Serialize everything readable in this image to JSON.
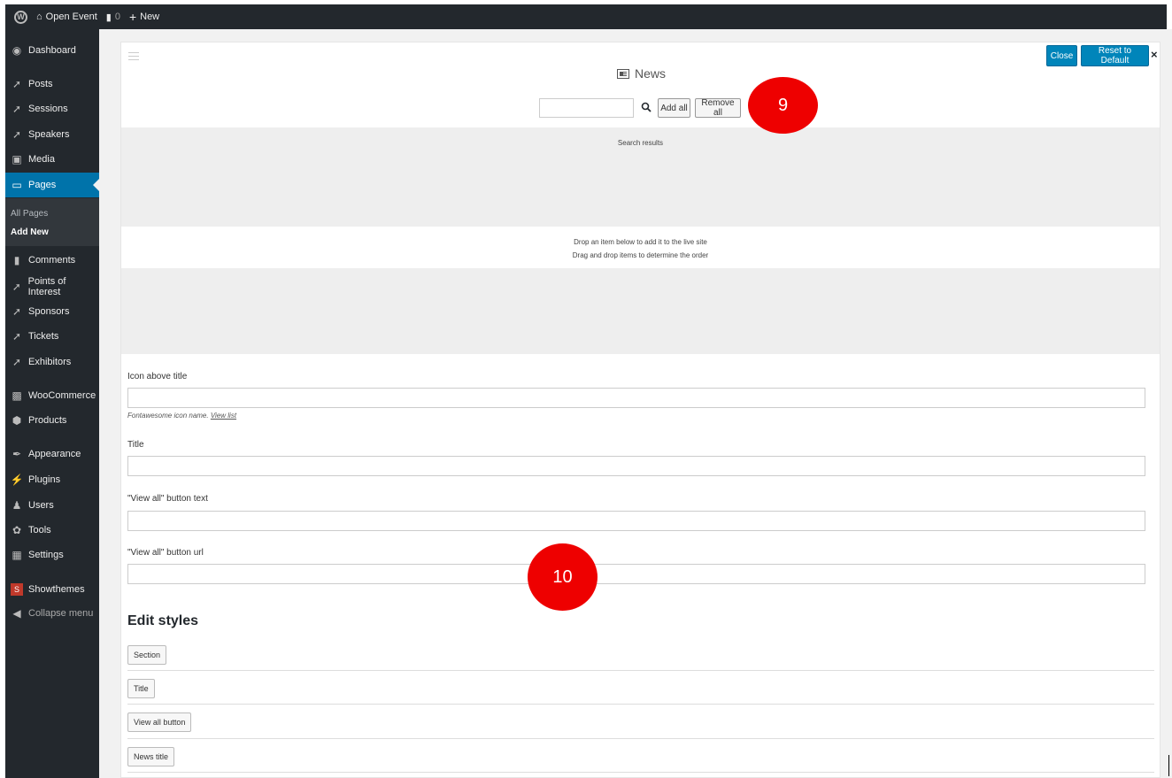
{
  "adminbar": {
    "site_name": "Open Event",
    "comments_count": "0",
    "new_label": "New"
  },
  "sidebar": {
    "items": [
      {
        "label": "Dashboard",
        "icon": "dashboard-icon"
      },
      {
        "label": "Posts",
        "icon": "pin-icon"
      },
      {
        "label": "Sessions",
        "icon": "pin-icon"
      },
      {
        "label": "Speakers",
        "icon": "pin-icon"
      },
      {
        "label": "Media",
        "icon": "media-icon"
      },
      {
        "label": "Pages",
        "icon": "pages-icon",
        "active": true
      },
      {
        "label": "Comments",
        "icon": "comment-icon"
      },
      {
        "label": "Points of Interest",
        "icon": "pin-icon"
      },
      {
        "label": "Sponsors",
        "icon": "pin-icon"
      },
      {
        "label": "Tickets",
        "icon": "pin-icon"
      },
      {
        "label": "Exhibitors",
        "icon": "pin-icon"
      },
      {
        "label": "WooCommerce",
        "icon": "woocommerce-icon"
      },
      {
        "label": "Products",
        "icon": "products-icon"
      },
      {
        "label": "Appearance",
        "icon": "brush-icon"
      },
      {
        "label": "Plugins",
        "icon": "plugin-icon"
      },
      {
        "label": "Users",
        "icon": "user-icon"
      },
      {
        "label": "Tools",
        "icon": "wrench-icon"
      },
      {
        "label": "Settings",
        "icon": "settings-icon"
      },
      {
        "label": "Showthemes",
        "icon": "showthemes-icon"
      },
      {
        "label": "Collapse menu",
        "icon": "collapse-icon"
      }
    ],
    "submenu": {
      "all_pages": "All Pages",
      "add_new": "Add New"
    }
  },
  "panel": {
    "close_label": "Close",
    "reset_label": "Reset to Default",
    "close_x": "×",
    "widget_title": "News",
    "search_placeholder": "",
    "add_all_label": "Add all",
    "remove_all_label": "Remove all",
    "search_results_label": "Search results",
    "drop_hint_1": "Drop an item below to add it to the live site",
    "drop_hint_2": "Drag and drop items to determine the order",
    "fields": {
      "icon_above_title": "Icon above title",
      "icon_help": "Fontawesome icon name.",
      "icon_help_link": "View list",
      "title": "Title",
      "view_all_text": "\"View all\" button text",
      "view_all_url": "\"View all\" button url"
    },
    "edit_styles_heading": "Edit styles",
    "style_buttons": [
      "Section",
      "Title",
      "View all button",
      "News title"
    ]
  },
  "annotations": {
    "badge_9": "9",
    "badge_10": "10"
  },
  "colors": {
    "admin_dark": "#23282d",
    "accent_blue": "#0073aa",
    "badge_red": "#e00000"
  }
}
